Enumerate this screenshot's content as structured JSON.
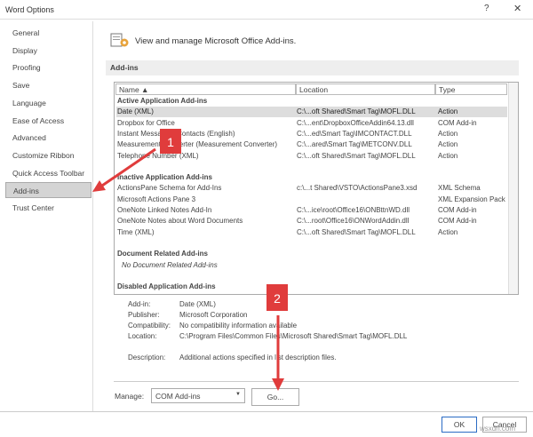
{
  "window": {
    "title": "Word Options",
    "help": "?",
    "close": "✕"
  },
  "sidebar": {
    "items": [
      {
        "label": "General"
      },
      {
        "label": "Display"
      },
      {
        "label": "Proofing"
      },
      {
        "label": "Save"
      },
      {
        "label": "Language"
      },
      {
        "label": "Ease of Access"
      },
      {
        "label": "Advanced"
      },
      {
        "label": "Customize Ribbon"
      },
      {
        "label": "Quick Access Toolbar"
      },
      {
        "label": "Add-ins",
        "selected": true
      },
      {
        "label": "Trust Center"
      }
    ]
  },
  "header": {
    "text": "View and manage Microsoft Office Add-ins.",
    "icon": "addins-gear-icon"
  },
  "section": {
    "title": "Add-ins"
  },
  "table": {
    "columns": [
      "Name ▲",
      "Location",
      "Type"
    ],
    "rows": [
      {
        "group": "Active Application Add-ins"
      },
      {
        "name": "Date (XML)",
        "location": "C:\\...oft Shared\\Smart Tag\\MOFL.DLL",
        "type": "Action",
        "selected": true
      },
      {
        "name": "Dropbox for Office",
        "location": "C:\\...ent\\DropboxOfficeAddin64.13.dll",
        "type": "COM Add-in"
      },
      {
        "name": "Instant Messaging Contacts (English)",
        "location": "C:\\...ed\\Smart Tag\\IMCONTACT.DLL",
        "type": "Action"
      },
      {
        "name": "Measurement Converter (Measurement Converter)",
        "location": "C:\\...ared\\Smart Tag\\METCONV.DLL",
        "type": "Action"
      },
      {
        "name": "Telephone Number (XML)",
        "location": "C:\\...oft Shared\\Smart Tag\\MOFL.DLL",
        "type": "Action"
      },
      {
        "blank": true
      },
      {
        "group": "Inactive Application Add-ins"
      },
      {
        "name": "ActionsPane Schema for Add-Ins",
        "location": "c:\\...t Shared\\VSTO\\ActionsPane3.xsd",
        "type": "XML Schema"
      },
      {
        "name": "Microsoft Actions Pane 3",
        "location": "",
        "type": "XML Expansion Pack"
      },
      {
        "name": "OneNote Linked Notes Add-In",
        "location": "C:\\...ice\\root\\Office16\\ONBttnWD.dll",
        "type": "COM Add-in"
      },
      {
        "name": "OneNote Notes about Word Documents",
        "location": "C:\\...root\\Office16\\ONWordAddin.dll",
        "type": "COM Add-in"
      },
      {
        "name": "Time (XML)",
        "location": "C:\\...oft Shared\\Smart Tag\\MOFL.DLL",
        "type": "Action"
      },
      {
        "blank": true
      },
      {
        "group": "Document Related Add-ins"
      },
      {
        "note": "No Document Related Add-ins"
      },
      {
        "blank": true
      },
      {
        "group": "Disabled Application Add-ins"
      }
    ]
  },
  "details": [
    {
      "label": "Add-in:",
      "value": "Date (XML)"
    },
    {
      "label": "Publisher:",
      "value": "Microsoft Corporation"
    },
    {
      "label": "Compatibility:",
      "value": "No compatibility information available"
    },
    {
      "label": "Location:",
      "value": "C:\\Program Files\\Common Files\\Microsoft Shared\\Smart Tag\\MOFL.DLL"
    },
    {
      "label": "Description:",
      "value": "Additional actions specified in list description files."
    }
  ],
  "manage": {
    "label": "Manage:",
    "value": "COM Add-ins",
    "go": "Go..."
  },
  "buttons": {
    "ok": "OK",
    "cancel": "Cancel"
  },
  "annotations": {
    "step1": "1",
    "step2": "2",
    "color": "#e03c3c"
  },
  "watermark": "wsxdn.com"
}
